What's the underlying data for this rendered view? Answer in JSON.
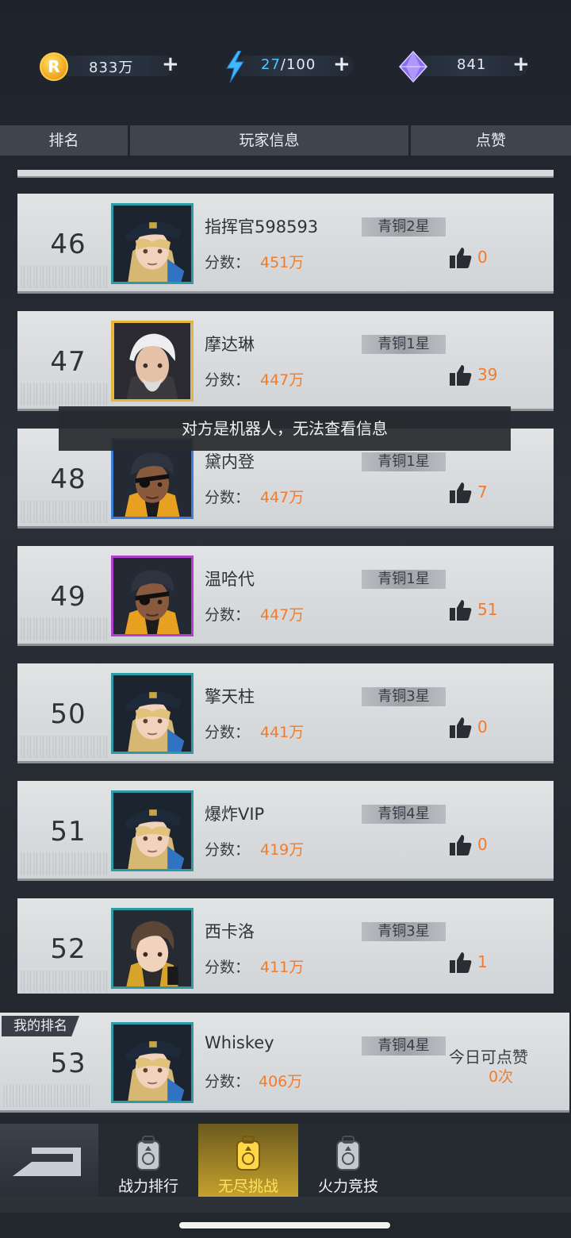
{
  "resources": {
    "gold": {
      "value": "833万",
      "icon": "gold-coin-icon"
    },
    "stamina": {
      "current": "27",
      "max": "/100",
      "icon": "lightning-icon"
    },
    "gems": {
      "value": "841",
      "icon": "diamond-icon"
    },
    "plus": "+"
  },
  "header": {
    "rank": "排名",
    "player_info": "玩家信息",
    "likes": "点赞"
  },
  "list": [
    {
      "rank": "46",
      "name": "指挥官598593",
      "tier": "青铜2星",
      "score_label": "分数：",
      "score": "451万",
      "likes": "0",
      "frame": "teal",
      "avatar": "officer"
    },
    {
      "rank": "47",
      "name": "摩达琳",
      "tier": "青铜1星",
      "score_label": "分数：",
      "score": "447万",
      "likes": "39",
      "frame": "gold",
      "avatar": "white-hair"
    },
    {
      "rank": "48",
      "name": "黛内登",
      "tier": "青铜1星",
      "score_label": "分数：",
      "score": "447万",
      "likes": "7",
      "frame": "blue",
      "avatar": "eyepatch"
    },
    {
      "rank": "49",
      "name": "温哈代",
      "tier": "青铜1星",
      "score_label": "分数：",
      "score": "447万",
      "likes": "51",
      "frame": "purple",
      "avatar": "eyepatch"
    },
    {
      "rank": "50",
      "name": "擎天柱",
      "tier": "青铜3星",
      "score_label": "分数：",
      "score": "441万",
      "likes": "0",
      "frame": "teal",
      "avatar": "officer"
    },
    {
      "rank": "51",
      "name": "爆炸VIP",
      "tier": "青铜4星",
      "score_label": "分数：",
      "score": "419万",
      "likes": "0",
      "frame": "teal",
      "avatar": "officer"
    },
    {
      "rank": "52",
      "name": "西卡洛",
      "tier": "青铜3星",
      "score_label": "分数：",
      "score": "411万",
      "likes": "1",
      "frame": "teal",
      "avatar": "brown-hair"
    }
  ],
  "toast": "对方是机器人，无法查看信息",
  "my_rank": {
    "badge": "我的排名",
    "rank": "53",
    "name": "Whiskey",
    "tier": "青铜4星",
    "score_label": "分数：",
    "score": "406万",
    "today_label": "今日可点赞",
    "today_value": "0次"
  },
  "nav": {
    "back_icon": "back-arrow-icon",
    "tabs": [
      {
        "label": "战力排行",
        "icon": "backpack-icon",
        "active": false
      },
      {
        "label": "无尽挑战",
        "icon": "backpack-icon",
        "active": true
      },
      {
        "label": "火力竞技",
        "icon": "backpack-icon",
        "active": false
      }
    ]
  },
  "colors": {
    "accent": "#f07c2c",
    "active_tab": "#c5a12e",
    "stamina": "#4bc8ff"
  }
}
